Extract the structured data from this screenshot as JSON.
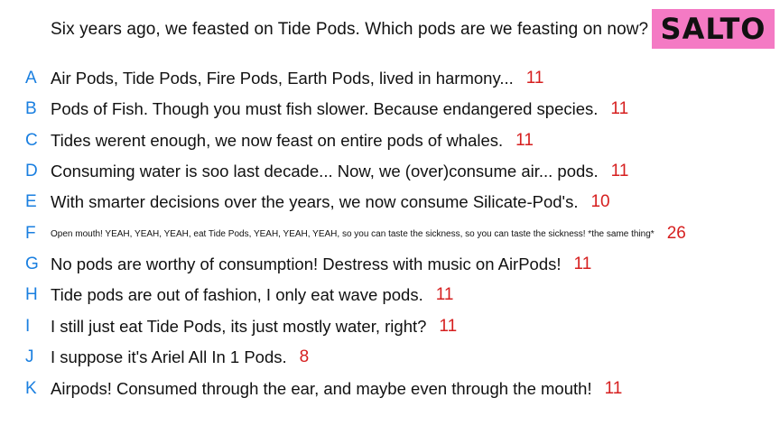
{
  "brand": "SALTO",
  "question": "Six years ago, we feasted on Tide Pods. Which pods are we feasting on now?",
  "answers": [
    {
      "letter": "A",
      "text": "Air Pods, Tide Pods, Fire Pods, Earth Pods, lived in harmony...",
      "count": "11"
    },
    {
      "letter": "B",
      "text": "Pods of Fish. Though you must fish slower. Because endangered species.",
      "count": "11"
    },
    {
      "letter": "C",
      "text": "Tides werent enough, we now feast on entire pods of whales.",
      "count": "11"
    },
    {
      "letter": "D",
      "text": "Consuming water is soo last decade... Now, we (over)consume air... pods.",
      "count": "11"
    },
    {
      "letter": "E",
      "text": "With smarter decisions over the years, we now consume Silicate-Pod's.",
      "count": "10"
    },
    {
      "letter": "F",
      "text": "Open mouth! YEAH, YEAH, YEAH, eat Tide Pods, YEAH, YEAH, YEAH, so you can taste the sickness, so you can taste the sickness! *the same thing*",
      "count": "26"
    },
    {
      "letter": "G",
      "text": "No pods are worthy of consumption! Destress with music on AirPods!",
      "count": "11"
    },
    {
      "letter": "H",
      "text": "Tide pods are out of fashion, I only eat wave pods.",
      "count": "11"
    },
    {
      "letter": "I",
      "text": "I still just eat Tide Pods, its just mostly water, right?",
      "count": "11"
    },
    {
      "letter": "J",
      "text": "I suppose it's Ariel All In 1 Pods.",
      "count": "8"
    },
    {
      "letter": "K",
      "text": "Airpods! Consumed through the ear, and maybe even through the mouth!",
      "count": "11"
    }
  ]
}
